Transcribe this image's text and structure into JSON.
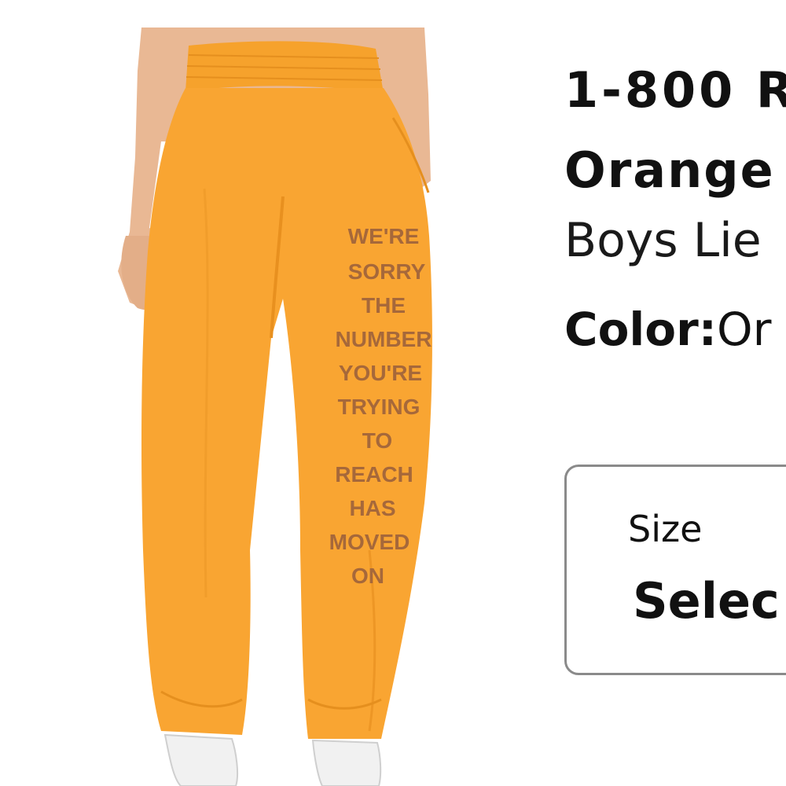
{
  "product": {
    "title_line1": "1-800 R",
    "title_line2": "Orange",
    "brand": "Boys Lie",
    "color_label": "Color:",
    "color_value": "Or",
    "image_icon": "product-photo-sweatpants",
    "print_lines": [
      "WE'RE",
      "SORRY",
      "THE",
      "NUMBER",
      "YOU'RE",
      "TRYING",
      "TO",
      "REACH",
      "HAS",
      "MOVED",
      "ON"
    ]
  },
  "size_selector": {
    "label": "Size",
    "value": "Selec"
  },
  "colors": {
    "product_orange": "#F9A532",
    "print_brown": "#A6683A",
    "border_gray": "#8A8A8A"
  }
}
